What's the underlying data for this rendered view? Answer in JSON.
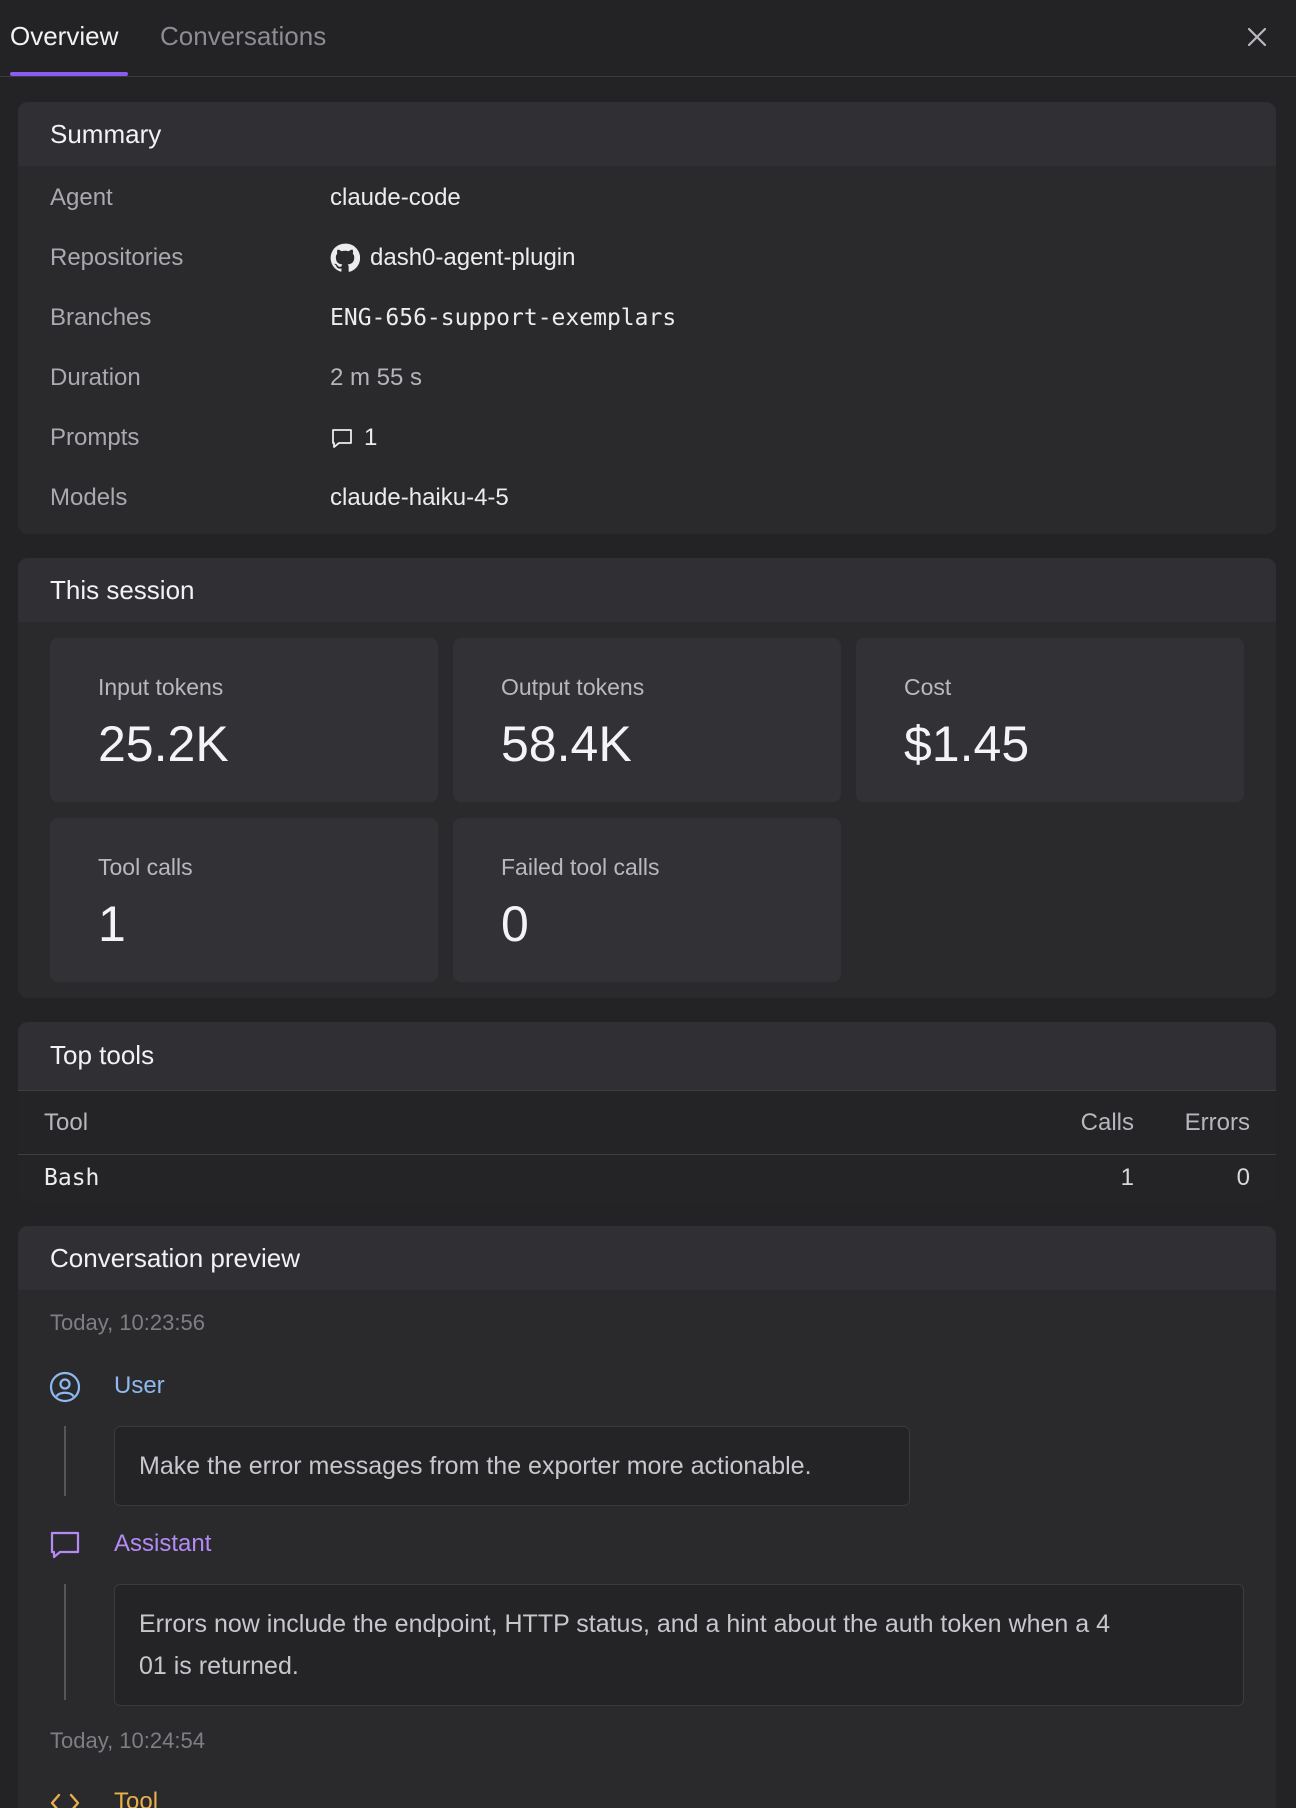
{
  "tabs": [
    {
      "label": "Overview",
      "active": true
    },
    {
      "label": "Conversations",
      "active": false
    }
  ],
  "summary": {
    "title": "Summary",
    "rows": [
      {
        "label": "Agent",
        "value": "claude-code"
      },
      {
        "label": "Repositories",
        "value": "dash0-agent-plugin",
        "icon": "github-icon"
      },
      {
        "label": "Branches",
        "value": "ENG-656-support-exemplars"
      },
      {
        "label": "Duration",
        "value": "2 m 55 s"
      },
      {
        "label": "Prompts",
        "value": "1",
        "icon": "chat-bubble-icon"
      },
      {
        "label": "Models",
        "value": "claude-haiku-4-5"
      }
    ]
  },
  "session": {
    "title": "This session",
    "cards": [
      {
        "label": "Input tokens",
        "value": "25.2K"
      },
      {
        "label": "Output tokens",
        "value": "58.4K"
      },
      {
        "label": "Cost",
        "value": "$1.45"
      },
      {
        "label": "Tool calls",
        "value": "1"
      },
      {
        "label": "Failed tool calls",
        "value": "0"
      }
    ]
  },
  "top_tools": {
    "title": "Top tools",
    "columns": [
      "Tool",
      "Calls",
      "Errors"
    ],
    "rows": [
      {
        "tool": "Bash",
        "calls": "1",
        "errors": "0"
      }
    ]
  },
  "conversation": {
    "title": "Conversation preview",
    "entries": [
      {
        "time": "Today, 10:23:56"
      },
      {
        "role": "User",
        "icon": "user-circle-icon",
        "color": "#8fb8f0",
        "text": "Make the error messages from the exporter more actionable."
      },
      {
        "role": "Assistant",
        "icon": "chat-bubble-icon",
        "color": "#b48af5",
        "text": "Errors now include the endpoint, HTTP status, and a hint about the auth token when a 4\n01 is returned."
      },
      {
        "time": "Today, 10:24:54"
      },
      {
        "role": "Tool",
        "icon": "code-icon",
        "color": "#e8b04a"
      }
    ]
  },
  "colors": {
    "accent": "#8a5cf0"
  }
}
